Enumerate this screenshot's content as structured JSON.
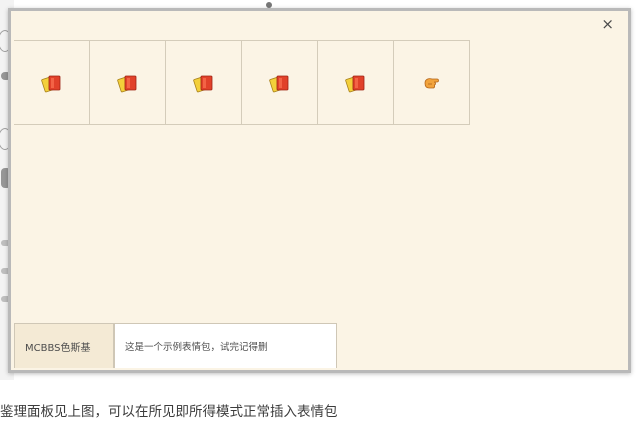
{
  "panel": {
    "close_label": "×",
    "emoticons": [
      {
        "icon": "red-card-icon"
      },
      {
        "icon": "red-card-icon"
      },
      {
        "icon": "red-card-icon"
      },
      {
        "icon": "red-card-icon"
      },
      {
        "icon": "red-card-icon"
      },
      {
        "icon": "hand-icon"
      }
    ],
    "tabs": [
      {
        "label": "MCBBS色斯基",
        "active": true
      },
      {
        "label": "这是一个示例表情包，试完记得删",
        "active": false
      }
    ]
  },
  "background": {
    "caption": "鉴理面板见上图，可以在所见即所得模式正常插入表情包"
  },
  "colors": {
    "panel_bg": "#fbf4e5",
    "panel_border": "#b9b9b9",
    "active_tab_bg": "#f4ead5",
    "card_red": "#e1412a",
    "card_yellow": "#f3cf3a"
  }
}
